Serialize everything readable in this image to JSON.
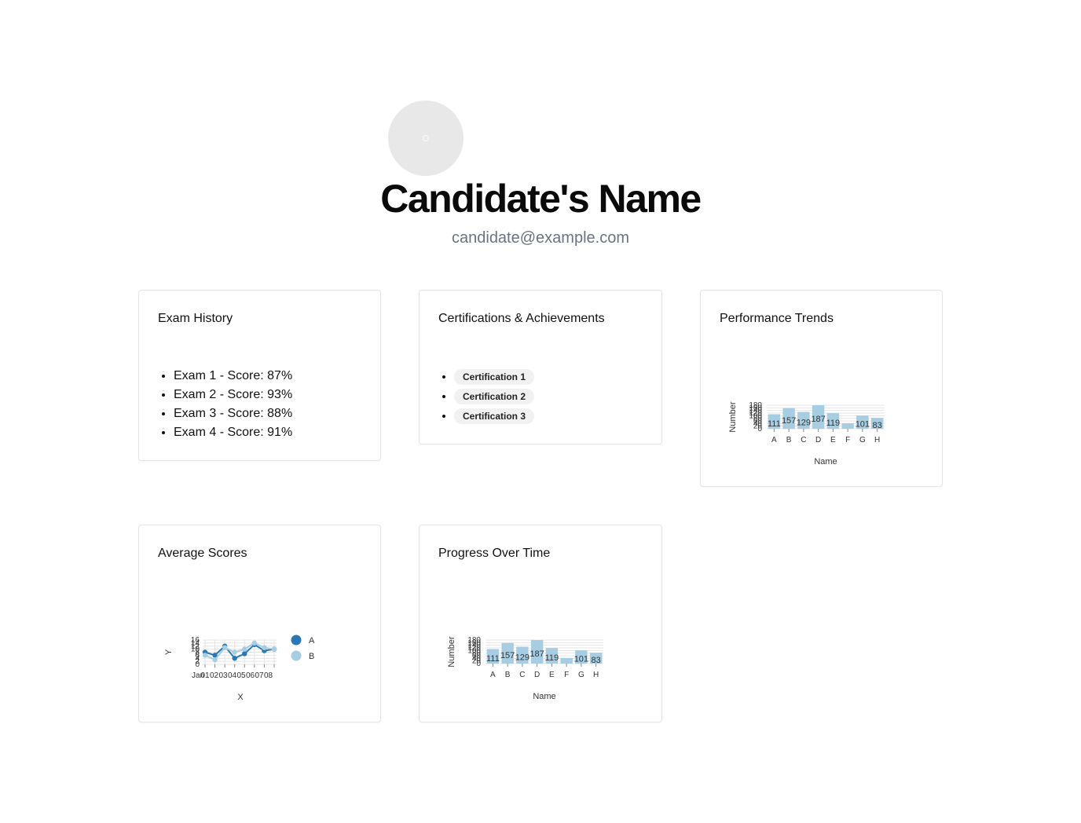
{
  "profile": {
    "name": "Candidate's Name",
    "email": "candidate@example.com",
    "avatar_icon": "user-avatar-placeholder"
  },
  "cards": {
    "exam_history": {
      "title": "Exam History",
      "items": [
        "Exam 1 - Score: 87%",
        "Exam 2 - Score: 93%",
        "Exam 3 - Score: 88%",
        "Exam 4 - Score: 91%"
      ]
    },
    "certifications": {
      "title": "Certifications & Achievements",
      "items": [
        "Certification 1",
        "Certification 2",
        "Certification 3"
      ]
    },
    "performance_trends": {
      "title": "Performance Trends"
    },
    "average_scores": {
      "title": "Average Scores"
    },
    "progress_over_time": {
      "title": "Progress Over Time"
    }
  },
  "colors": {
    "bar": "#a6cde2",
    "series_a": "#2a78b5",
    "series_b": "#a6cde2",
    "muted_text": "#6b7280"
  },
  "chart_data": [
    {
      "type": "bar",
      "card": "Performance Trends",
      "categories": [
        "A",
        "B",
        "C",
        "D",
        "E",
        "F",
        "G",
        "H"
      ],
      "values": [
        111,
        157,
        129,
        187,
        119,
        43,
        101,
        83
      ],
      "value_labels": [
        "111",
        "157",
        "129",
        "187",
        "119",
        "",
        "101",
        "83"
      ],
      "xlabel": "Name",
      "ylabel": "Number",
      "ylim": [
        0,
        180
      ],
      "yticks": [
        "0",
        "20",
        "40",
        "60",
        "80",
        "100",
        "120",
        "140",
        "160",
        "180"
      ],
      "grid": true
    },
    {
      "type": "line",
      "card": "Average Scores",
      "x": [
        "Jan",
        "2000-01-02",
        "2000-01-03",
        "2000-01-04",
        "2000-01-05",
        "2000-01-06",
        "2000-01-07",
        "2000-01-08"
      ],
      "xtick_labels": [
        "Jan",
        "01",
        "02",
        "03",
        "04",
        "05",
        "06",
        "07",
        "08"
      ],
      "series": [
        {
          "name": "A",
          "values": [
            8,
            6,
            12,
            4,
            7,
            13,
            9,
            10
          ]
        },
        {
          "name": "B",
          "values": [
            6,
            3,
            11,
            8,
            10,
            14,
            11,
            10
          ]
        }
      ],
      "xlabel": "X",
      "ylabel": "Y",
      "ylim": [
        0,
        16
      ],
      "yticks": [
        "0",
        "2",
        "4",
        "6",
        "8",
        "10",
        "12",
        "14",
        "16"
      ],
      "legend": "right",
      "grid": true
    },
    {
      "type": "bar",
      "card": "Progress Over Time",
      "categories": [
        "A",
        "B",
        "C",
        "D",
        "E",
        "F",
        "G",
        "H"
      ],
      "values": [
        111,
        157,
        129,
        187,
        119,
        43,
        101,
        83
      ],
      "value_labels": [
        "111",
        "157",
        "129",
        "187",
        "119",
        "",
        "101",
        "83"
      ],
      "xlabel": "Name",
      "ylabel": "Number",
      "ylim": [
        0,
        180
      ],
      "yticks": [
        "0",
        "20",
        "40",
        "60",
        "80",
        "100",
        "120",
        "140",
        "160",
        "180"
      ],
      "grid": true
    }
  ]
}
